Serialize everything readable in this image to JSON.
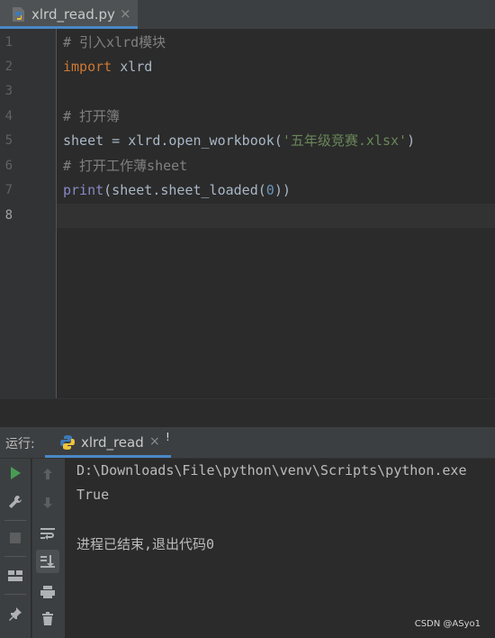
{
  "editor_tab": {
    "filename": "xlrd_read.py",
    "close": "×"
  },
  "editor": {
    "line_numbers": [
      "1",
      "2",
      "3",
      "4",
      "5",
      "6",
      "7",
      "8"
    ],
    "lines": {
      "l1_comment": "# 引入xlrd模块",
      "l2_kw": "import",
      "l2_rest": " xlrd",
      "l4_comment": "# 打开簿",
      "l5_a": "sheet = xlrd.open_workbook(",
      "l5_str": "'五年级竞赛.xlsx'",
      "l5_b": ")",
      "l6_comment": "# 打开工作薄sheet",
      "l7_builtin": "print",
      "l7_a": "(sheet.sheet_loaded(",
      "l7_num": "0",
      "l7_b": "))"
    }
  },
  "run_panel": {
    "title": "运行:",
    "tab_label": "xlrd_read",
    "tab_close": "×",
    "marker": "!",
    "console": [
      "D:\\Downloads\\File\\python\\venv\\Scripts\\python.exe",
      "True",
      "",
      "进程已结束,退出代码0"
    ]
  },
  "watermark": "CSDN @ASyo1",
  "colors": {
    "accent": "#4a88c7",
    "run_green": "#499c54",
    "keyword": "#cc7832",
    "string": "#6a8759",
    "number": "#6897bb",
    "builtin": "#8888c6",
    "comment": "#808080"
  },
  "icons": [
    "python-file-icon",
    "run-icon",
    "wrench-icon",
    "stop-icon",
    "layout-icon",
    "pin-icon",
    "up-arrow-icon",
    "down-arrow-icon",
    "soft-wrap-icon",
    "scroll-to-end-icon",
    "print-icon",
    "trash-icon"
  ]
}
